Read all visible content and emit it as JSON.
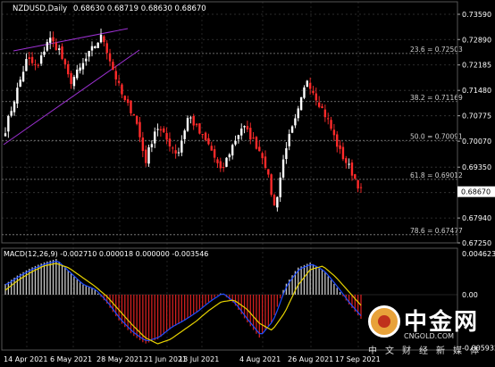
{
  "header": {
    "symbol": "NZDUSD,Daily",
    "ohlc": "0.68630 0.68719 0.68630 0.68670"
  },
  "price_axis": {
    "ticks": [
      "0.73590",
      "0.72890",
      "0.72185",
      "0.71480",
      "0.70775",
      "0.70070",
      "0.69350",
      "0.68645",
      "0.67940",
      "0.67250"
    ],
    "current_price": "0.68670"
  },
  "fibonacci": [
    {
      "label": "23.6 = 0.72503",
      "value": 0.72503
    },
    {
      "label": "38.2 = 0.71169",
      "value": 0.71169
    },
    {
      "label": "50.0 = 0.70091",
      "value": 0.70091
    },
    {
      "label": "61.8 = 0.69012",
      "value": 0.69012
    },
    {
      "label": "78.6 = 0.67477",
      "value": 0.67477
    }
  ],
  "macd": {
    "label": "MACD(12,26,9) -0.002710 0.000018 0.000000 -0.003546",
    "ticks": [
      "0.004623",
      "0.00",
      "-0.005932"
    ]
  },
  "time_axis": [
    "14 Apr 2021",
    "6 May 2021",
    "28 May 2021",
    "21 Jun 2021",
    "13 Jul 2021",
    "4 Aug 2021",
    "26 Aug 2021",
    "17 Sep 2021"
  ],
  "watermark": {
    "name": "中金网",
    "url": "CNGOLD.COM",
    "tagline": "中文财经新媒体"
  },
  "colors": {
    "background": "#000000",
    "bull": "#ffffff",
    "bear": "#ff2a2a",
    "grid": "#3a3a3a",
    "channel": "#9b30d0",
    "macd_main": "#1f4dff",
    "macd_signal": "#e6d200",
    "macd_hist_pos": "#c8c8c8",
    "macd_hist_neg": "#d02020",
    "axis_text": "#ffffff"
  },
  "chart_data": {
    "type": "candlestick",
    "title": "NZDUSD,Daily",
    "xlabel": "",
    "ylabel": "",
    "ylim": [
      0.6725,
      0.7359
    ],
    "close_path": [
      0.704,
      0.714,
      0.7235,
      0.721,
      0.7295,
      0.726,
      0.717,
      0.721,
      0.726,
      0.73,
      0.7205,
      0.712,
      0.708,
      0.695,
      0.705,
      0.701,
      0.697,
      0.708,
      0.703,
      0.699,
      0.692,
      0.699,
      0.705,
      0.701,
      0.696,
      0.682,
      0.699,
      0.707,
      0.718,
      0.712,
      0.706,
      0.698,
      0.693,
      0.687
    ],
    "macd_path": [
      0.0012,
      0.0022,
      0.003,
      0.0036,
      0.004,
      0.0026,
      0.0012,
      0.0006,
      -0.001,
      -0.003,
      -0.0045,
      -0.0055,
      -0.005,
      -0.0038,
      -0.003,
      -0.002,
      -0.0008,
      0.0002,
      -0.001,
      -0.003,
      -0.0048,
      -0.003,
      0.001,
      0.003,
      0.0036,
      0.0028,
      0.001,
      -0.001,
      -0.0027
    ],
    "signal_path": [
      0.0005,
      0.0016,
      0.0025,
      0.0032,
      0.0035,
      0.003,
      0.002,
      0.001,
      -0.0002,
      -0.0018,
      -0.0034,
      -0.0048,
      -0.0055,
      -0.005,
      -0.004,
      -0.003,
      -0.0018,
      -0.0008,
      -0.0006,
      -0.0016,
      -0.0032,
      -0.004,
      -0.002,
      0.001,
      0.0028,
      0.0032,
      0.002,
      0.0004,
      -0.0012
    ]
  }
}
